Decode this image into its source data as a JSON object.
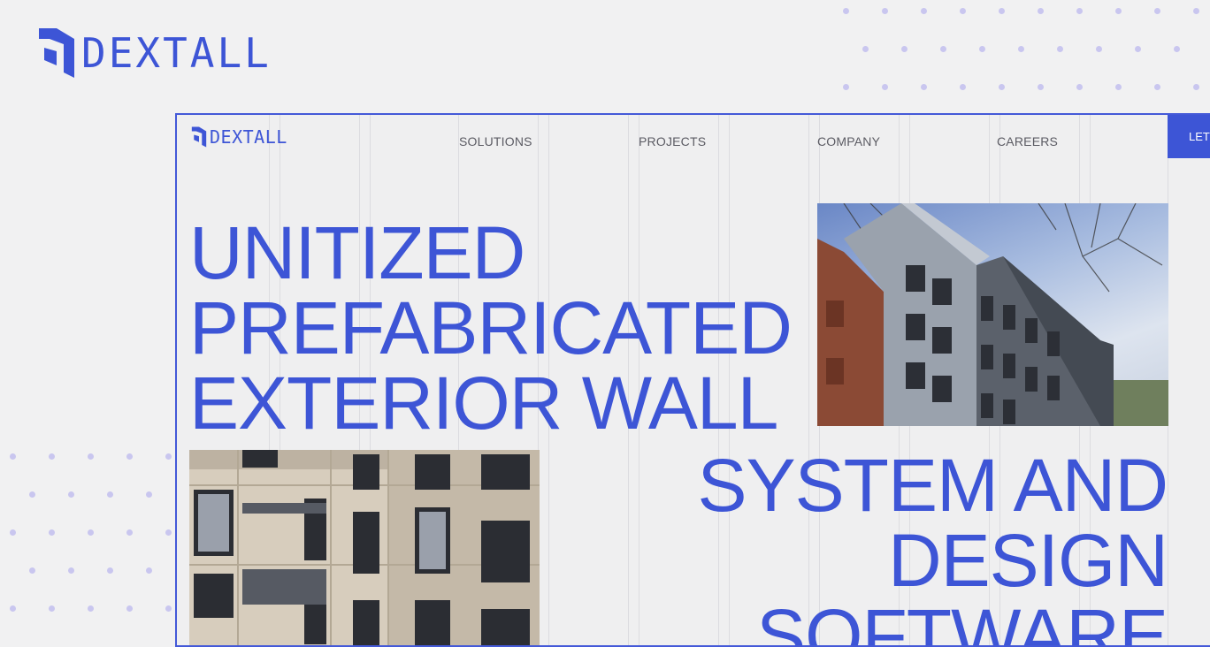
{
  "brand": {
    "name": "DEXTALL"
  },
  "nav": {
    "logo_text": "DEXTALL",
    "links": [
      "SOLUTIONS",
      "PROJECTS",
      "COMPANY",
      "CAREERS"
    ],
    "cta_label": "LET"
  },
  "hero": {
    "headline_line1": "UNITIZED",
    "headline_line2": "PREFABRICATED",
    "headline_line3": "EXTERIOR WALL",
    "headline_line4": "SYSTEM AND",
    "headline_line5": "DESIGN",
    "headline_line6": "SOFTWARE"
  },
  "colors": {
    "accent": "#3d55d6",
    "dots": "#c9c6ef",
    "background": "#f1f1f2"
  },
  "icons": {
    "logo_mark": "dextall-logo-mark-icon"
  }
}
